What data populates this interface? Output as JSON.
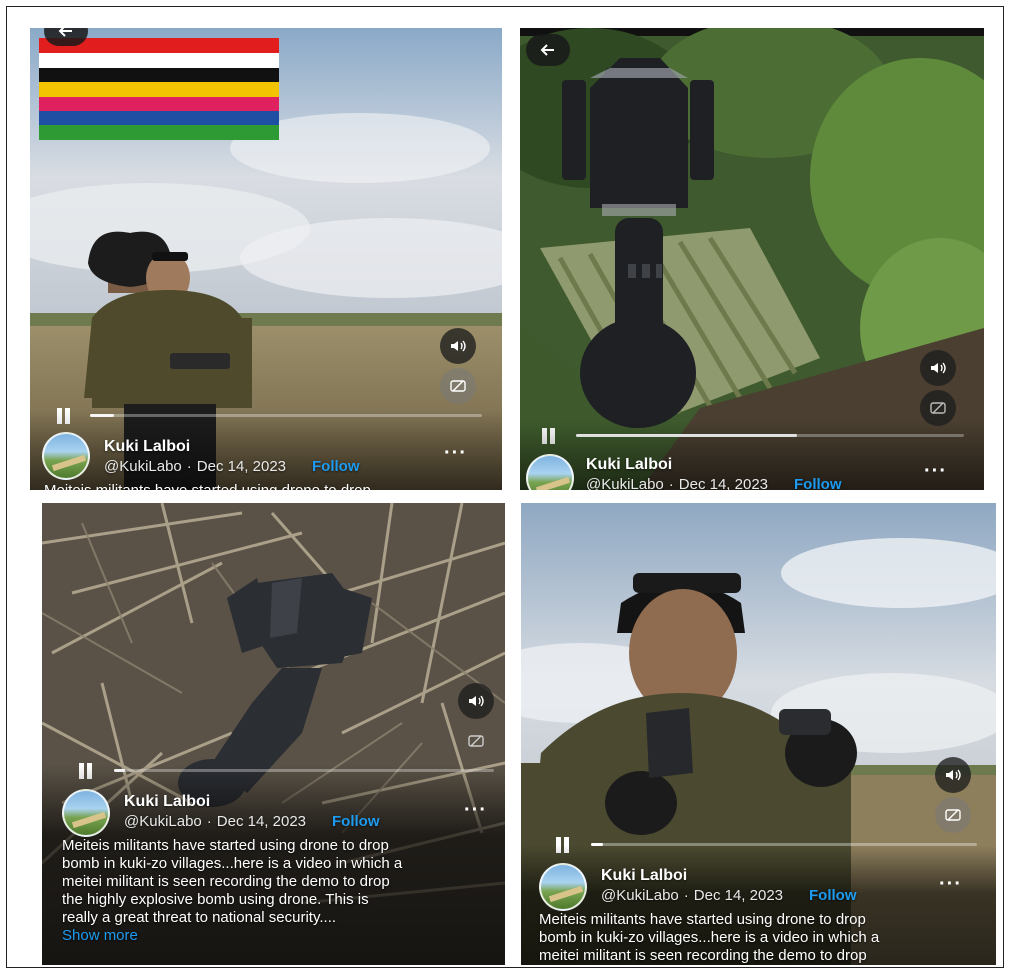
{
  "posts": [
    {
      "user": {
        "name": "Kuki Lalboi",
        "handle": "@KukiLabo",
        "date": "Dec 14, 2023",
        "follow": "Follow"
      },
      "caption_lines": [
        "Meiteis militants have started using drone to drop"
      ],
      "progress": 0.06
    },
    {
      "user": {
        "name": "Kuki Lalboi",
        "handle": "@KukiLabo",
        "date": "Dec 14, 2023",
        "follow": "Follow"
      },
      "caption_lines": [],
      "progress": 0.57
    },
    {
      "user": {
        "name": "Kuki Lalboi",
        "handle": "@KukiLabo",
        "date": "Dec 14, 2023",
        "follow": "Follow"
      },
      "caption_lines": [
        "Meiteis militants have started using drone to drop",
        "bomb in kuki-zo villages...here is a video in which a",
        "meitei militant is seen recording the demo to drop",
        "the highly explosive bomb using drone. This is",
        "really a great threat to national security...."
      ],
      "show_more": "Show more",
      "progress": 0.03
    },
    {
      "user": {
        "name": "Kuki Lalboi",
        "handle": "@KukiLabo",
        "date": "Dec 14, 2023",
        "follow": "Follow"
      },
      "caption_lines": [
        "Meiteis militants have started using drone to drop",
        "bomb in kuki-zo villages...here is a video in which a",
        "meitei militant is seen recording the demo to drop"
      ],
      "progress": 0.03
    }
  ],
  "flag_colors": [
    "#e11d1d",
    "#ffffff",
    "#111111",
    "#f2c300",
    "#e0215f",
    "#1f4fa3",
    "#2e9a34"
  ],
  "icons": [
    "back-arrow-icon",
    "speaker-icon",
    "captions-icon",
    "pause-icon",
    "more-options-icon"
  ],
  "accent_color": "#1d9bf0"
}
